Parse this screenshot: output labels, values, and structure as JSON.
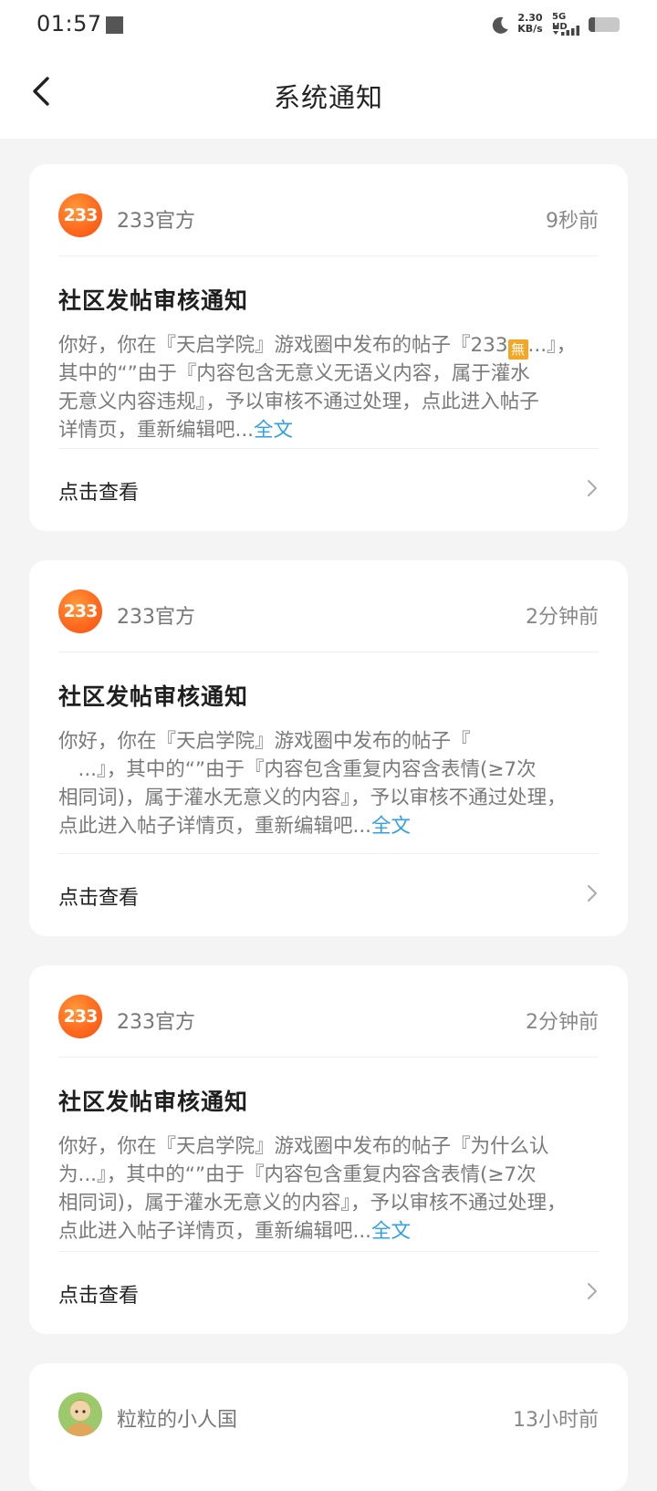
{
  "status_bar": {
    "time": "01:57",
    "net_speed_value": "2.30",
    "net_speed_unit": "KB/s",
    "network_type": "5G HD",
    "battery_level": 0.22,
    "icons": [
      "moon-icon",
      "signal-icon",
      "battery-icon"
    ]
  },
  "header": {
    "title": "系统通知",
    "back_icon": "chevron-left-icon"
  },
  "colors": {
    "link": "#2f9fe6",
    "avatar_orange": "#ff6a1f",
    "background": "#f4f4f4"
  },
  "notifications": [
    {
      "sender": "233官方",
      "avatar_text": "233",
      "time": "9秒前",
      "title": "社区发帖审核通知",
      "body_lines": [
        "你好，你在『天启学院』游戏圈中发布的帖子『233",
        "其中的“”由于『内容包含无意义无语义内容，属于灌水",
        "无意义内容违规』，予以审核不通过处理，点此进入帖子",
        "详情页，重新编辑吧..."
      ],
      "emoji_char": "無",
      "line1_tail": "...』，",
      "full_text_link": "全文",
      "action_label": "点击查看"
    },
    {
      "sender": "233官方",
      "avatar_text": "233",
      "time": "2分钟前",
      "title": "社区发帖审核通知",
      "body_lines": [
        "你好，你在『天启学院』游戏圈中发布的帖子『",
        "　...』，其中的“”由于『内容包含重复内容含表情(≥7次",
        "相同词)，属于灌水无意义的内容』，予以审核不通过处理，",
        "点此进入帖子详情页，重新编辑吧..."
      ],
      "full_text_link": "全文",
      "action_label": "点击查看"
    },
    {
      "sender": "233官方",
      "avatar_text": "233",
      "time": "2分钟前",
      "title": "社区发帖审核通知",
      "body_lines": [
        "你好，你在『天启学院』游戏圈中发布的帖子『为什么认",
        "为...』，其中的“”由于『内容包含重复内容含表情(≥7次",
        "相同词)，属于灌水无意义的内容』，予以审核不通过处理，",
        "点此进入帖子详情页，重新编辑吧..."
      ],
      "full_text_link": "全文",
      "action_label": "点击查看"
    },
    {
      "sender": "粒粒的小人国",
      "time": "13小时前"
    }
  ]
}
